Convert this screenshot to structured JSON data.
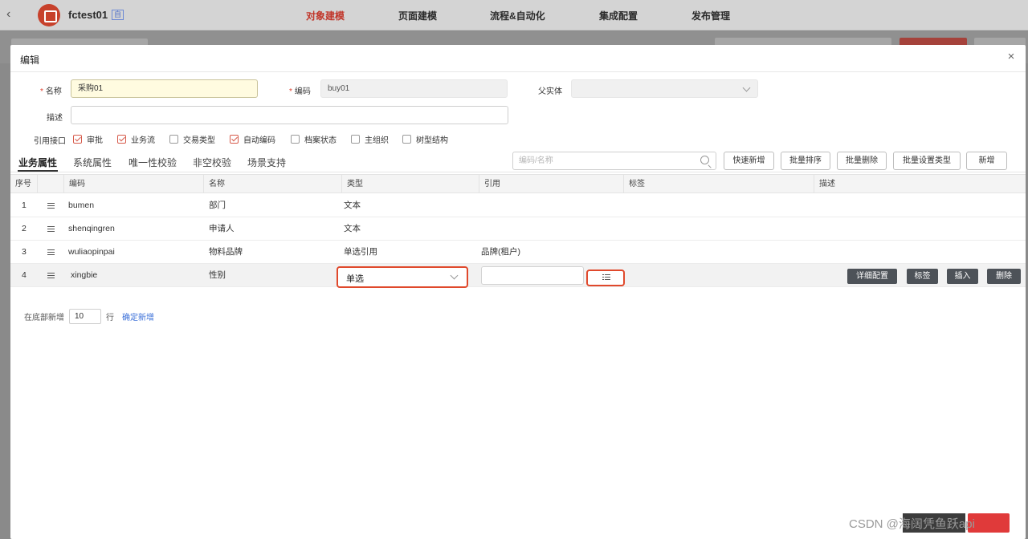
{
  "topbar": {
    "app_name": "fctest01",
    "app_badge": "自",
    "nav": [
      "对象建模",
      "页面建模",
      "流程&自动化",
      "集成配置",
      "发布管理"
    ],
    "active_nav": "对象建模"
  },
  "modal": {
    "title": "编辑",
    "close": "×",
    "form": {
      "name_label": "名称",
      "name_value": "采购01",
      "code_label": "编码",
      "code_value": "buy01",
      "parent_label": "父实体",
      "parent_value": "",
      "desc_label": "描述",
      "desc_value": "",
      "iface_label": "引用接口",
      "checkboxes": [
        {
          "label": "审批",
          "checked": true
        },
        {
          "label": "业务流",
          "checked": true
        },
        {
          "label": "交易类型",
          "checked": false
        },
        {
          "label": "自动编码",
          "checked": true
        },
        {
          "label": "档案状态",
          "checked": false
        },
        {
          "label": "主组织",
          "checked": false
        },
        {
          "label": "树型结构",
          "checked": false
        }
      ]
    },
    "tabs": [
      "业务属性",
      "系统属性",
      "唯一性校验",
      "非空校验",
      "场景支持"
    ],
    "active_tab": "业务属性",
    "search_placeholder": "编码/名称",
    "toolbar": [
      "快速新增",
      "批量排序",
      "批量删除",
      "批量设置类型",
      "新增"
    ],
    "table": {
      "headers": [
        "序号",
        "",
        "编码",
        "名称",
        "类型",
        "引用",
        "标签",
        "描述"
      ],
      "rows": [
        {
          "no": "1",
          "code": "bumen",
          "name": "部门",
          "type": "文本",
          "ref": ""
        },
        {
          "no": "2",
          "code": "shenqingren",
          "name": "申请人",
          "type": "文本",
          "ref": ""
        },
        {
          "no": "3",
          "code": "wuliaopinpai",
          "name": "物料品牌",
          "type": "单选引用",
          "ref": "品牌(租户)"
        },
        {
          "no": "4",
          "code": "xingbie",
          "name": "性别",
          "type": "单选",
          "ref": ""
        }
      ],
      "row_actions": [
        "详细配置",
        "标签",
        "插入",
        "删除"
      ]
    },
    "footer": {
      "prefix": "在底部新增",
      "count": "10",
      "suffix": "行",
      "confirm": "确定新增"
    }
  },
  "watermark": "CSDN @海阔凭鱼跃api"
}
